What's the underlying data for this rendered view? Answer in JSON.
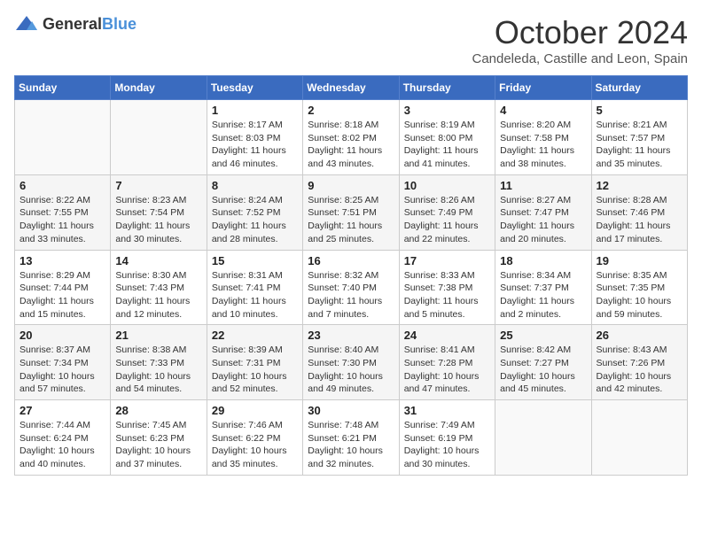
{
  "logo": {
    "general": "General",
    "blue": "Blue"
  },
  "title": "October 2024",
  "location": "Candeleda, Castille and Leon, Spain",
  "days_header": [
    "Sunday",
    "Monday",
    "Tuesday",
    "Wednesday",
    "Thursday",
    "Friday",
    "Saturday"
  ],
  "weeks": [
    [
      {
        "day": "",
        "info": ""
      },
      {
        "day": "",
        "info": ""
      },
      {
        "day": "1",
        "info": "Sunrise: 8:17 AM\nSunset: 8:03 PM\nDaylight: 11 hours and 46 minutes."
      },
      {
        "day": "2",
        "info": "Sunrise: 8:18 AM\nSunset: 8:02 PM\nDaylight: 11 hours and 43 minutes."
      },
      {
        "day": "3",
        "info": "Sunrise: 8:19 AM\nSunset: 8:00 PM\nDaylight: 11 hours and 41 minutes."
      },
      {
        "day": "4",
        "info": "Sunrise: 8:20 AM\nSunset: 7:58 PM\nDaylight: 11 hours and 38 minutes."
      },
      {
        "day": "5",
        "info": "Sunrise: 8:21 AM\nSunset: 7:57 PM\nDaylight: 11 hours and 35 minutes."
      }
    ],
    [
      {
        "day": "6",
        "info": "Sunrise: 8:22 AM\nSunset: 7:55 PM\nDaylight: 11 hours and 33 minutes."
      },
      {
        "day": "7",
        "info": "Sunrise: 8:23 AM\nSunset: 7:54 PM\nDaylight: 11 hours and 30 minutes."
      },
      {
        "day": "8",
        "info": "Sunrise: 8:24 AM\nSunset: 7:52 PM\nDaylight: 11 hours and 28 minutes."
      },
      {
        "day": "9",
        "info": "Sunrise: 8:25 AM\nSunset: 7:51 PM\nDaylight: 11 hours and 25 minutes."
      },
      {
        "day": "10",
        "info": "Sunrise: 8:26 AM\nSunset: 7:49 PM\nDaylight: 11 hours and 22 minutes."
      },
      {
        "day": "11",
        "info": "Sunrise: 8:27 AM\nSunset: 7:47 PM\nDaylight: 11 hours and 20 minutes."
      },
      {
        "day": "12",
        "info": "Sunrise: 8:28 AM\nSunset: 7:46 PM\nDaylight: 11 hours and 17 minutes."
      }
    ],
    [
      {
        "day": "13",
        "info": "Sunrise: 8:29 AM\nSunset: 7:44 PM\nDaylight: 11 hours and 15 minutes."
      },
      {
        "day": "14",
        "info": "Sunrise: 8:30 AM\nSunset: 7:43 PM\nDaylight: 11 hours and 12 minutes."
      },
      {
        "day": "15",
        "info": "Sunrise: 8:31 AM\nSunset: 7:41 PM\nDaylight: 11 hours and 10 minutes."
      },
      {
        "day": "16",
        "info": "Sunrise: 8:32 AM\nSunset: 7:40 PM\nDaylight: 11 hours and 7 minutes."
      },
      {
        "day": "17",
        "info": "Sunrise: 8:33 AM\nSunset: 7:38 PM\nDaylight: 11 hours and 5 minutes."
      },
      {
        "day": "18",
        "info": "Sunrise: 8:34 AM\nSunset: 7:37 PM\nDaylight: 11 hours and 2 minutes."
      },
      {
        "day": "19",
        "info": "Sunrise: 8:35 AM\nSunset: 7:35 PM\nDaylight: 10 hours and 59 minutes."
      }
    ],
    [
      {
        "day": "20",
        "info": "Sunrise: 8:37 AM\nSunset: 7:34 PM\nDaylight: 10 hours and 57 minutes."
      },
      {
        "day": "21",
        "info": "Sunrise: 8:38 AM\nSunset: 7:33 PM\nDaylight: 10 hours and 54 minutes."
      },
      {
        "day": "22",
        "info": "Sunrise: 8:39 AM\nSunset: 7:31 PM\nDaylight: 10 hours and 52 minutes."
      },
      {
        "day": "23",
        "info": "Sunrise: 8:40 AM\nSunset: 7:30 PM\nDaylight: 10 hours and 49 minutes."
      },
      {
        "day": "24",
        "info": "Sunrise: 8:41 AM\nSunset: 7:28 PM\nDaylight: 10 hours and 47 minutes."
      },
      {
        "day": "25",
        "info": "Sunrise: 8:42 AM\nSunset: 7:27 PM\nDaylight: 10 hours and 45 minutes."
      },
      {
        "day": "26",
        "info": "Sunrise: 8:43 AM\nSunset: 7:26 PM\nDaylight: 10 hours and 42 minutes."
      }
    ],
    [
      {
        "day": "27",
        "info": "Sunrise: 7:44 AM\nSunset: 6:24 PM\nDaylight: 10 hours and 40 minutes."
      },
      {
        "day": "28",
        "info": "Sunrise: 7:45 AM\nSunset: 6:23 PM\nDaylight: 10 hours and 37 minutes."
      },
      {
        "day": "29",
        "info": "Sunrise: 7:46 AM\nSunset: 6:22 PM\nDaylight: 10 hours and 35 minutes."
      },
      {
        "day": "30",
        "info": "Sunrise: 7:48 AM\nSunset: 6:21 PM\nDaylight: 10 hours and 32 minutes."
      },
      {
        "day": "31",
        "info": "Sunrise: 7:49 AM\nSunset: 6:19 PM\nDaylight: 10 hours and 30 minutes."
      },
      {
        "day": "",
        "info": ""
      },
      {
        "day": "",
        "info": ""
      }
    ]
  ]
}
